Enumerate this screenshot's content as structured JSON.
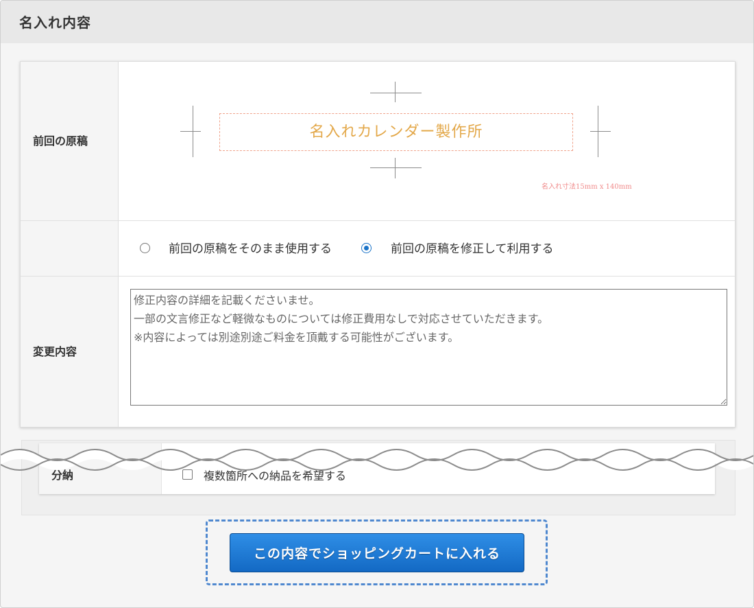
{
  "section": {
    "title": "名入れ内容"
  },
  "form": {
    "previous_draft_label": "前回の原稿",
    "preview_text": "名入れカレンダー製作所",
    "dimension_note": "名入れ寸法15mm x 140mm",
    "options": [
      {
        "label": "前回の原稿をそのまま使用する",
        "checked": false
      },
      {
        "label": "前回の原稿を修正して利用する",
        "checked": true
      }
    ],
    "changes_label": "変更内容",
    "changes_placeholder": "修正内容の詳細を記載くださいませ。\n一部の文言修正など軽微なものについては修正費用なしで対応させていただきます。\n※内容によっては別途別途ご料金を頂戴する可能性がございます。"
  },
  "delivery": {
    "label": "分納",
    "checkbox_label": "複数箇所への納品を希望する"
  },
  "cta": {
    "label": "この内容でショッピングカートに入れる"
  }
}
